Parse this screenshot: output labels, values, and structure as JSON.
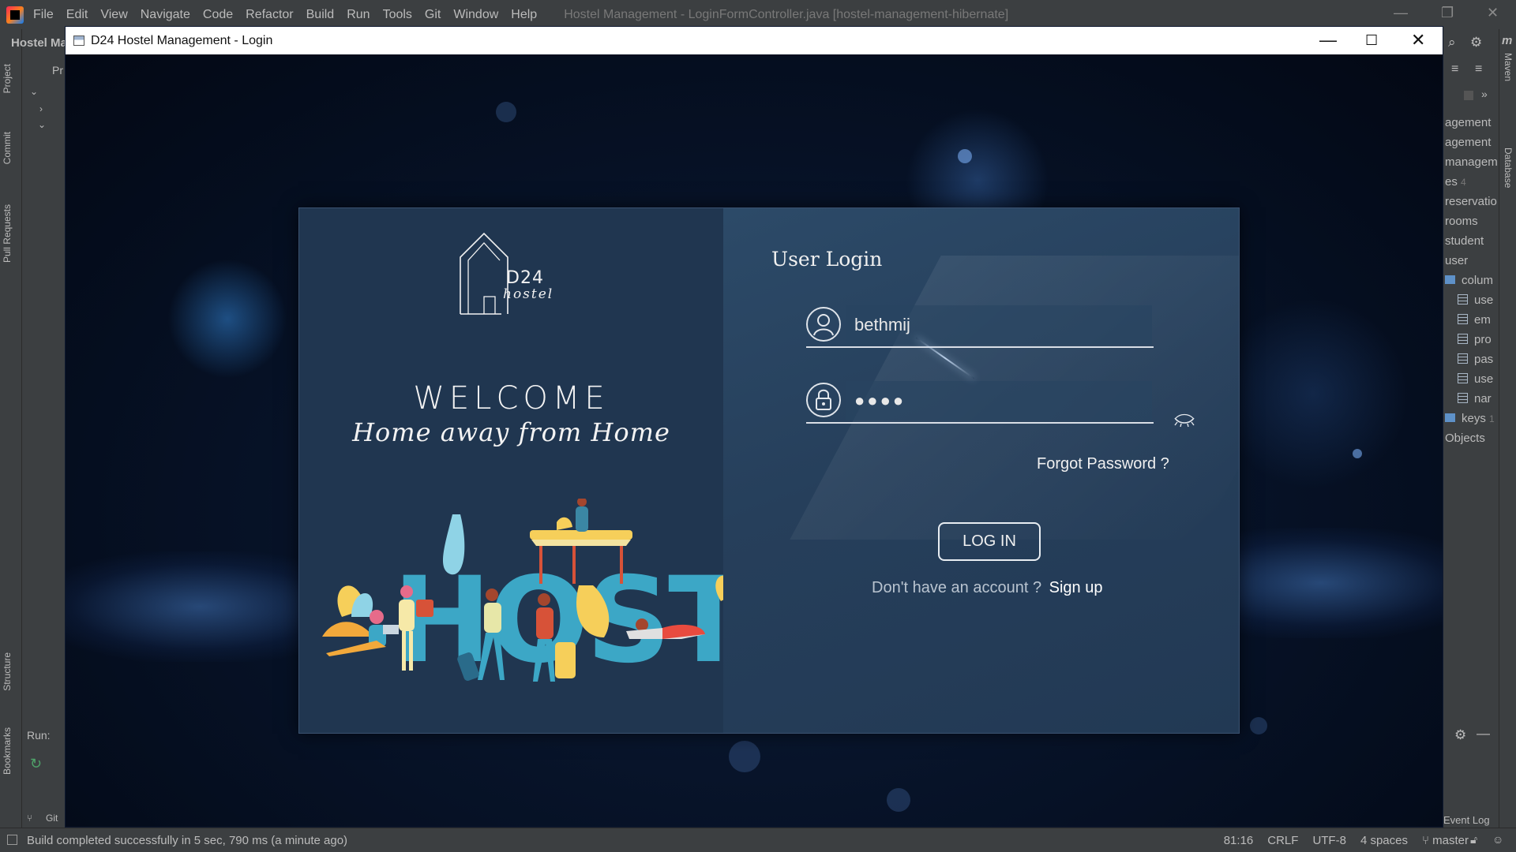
{
  "ide": {
    "menu": [
      "File",
      "Edit",
      "View",
      "Navigate",
      "Code",
      "Refactor",
      "Build",
      "Run",
      "Tools",
      "Git",
      "Window",
      "Help"
    ],
    "window_title": "Hostel Management - LoginFormController.java [hostel-management-hibernate]",
    "project_title": "Hostel Ma",
    "project_tab_label": "Pr",
    "left_tabs": [
      "Project",
      "Commit",
      "Pull Requests",
      "Structure",
      "Bookmarks"
    ],
    "right_tabs": [
      "Maven",
      "Database"
    ],
    "database_items": [
      "agement",
      "agement",
      "managem",
      "es",
      "reservatio",
      "rooms",
      "student",
      "user",
      "colum",
      "use",
      "em",
      "pro",
      "pas",
      "use",
      "nar",
      "keys",
      "Objects"
    ],
    "database_counts": {
      "es": "4",
      "keys": "1"
    },
    "run_label": "Run:",
    "git_label": "Git",
    "event_log": "Event Log",
    "status": {
      "message": "Build completed successfully in 5 sec, 790 ms (a minute ago)",
      "position": "81:16",
      "line_ending": "CRLF",
      "encoding": "UTF-8",
      "indent": "4 spaces",
      "branch": "master"
    }
  },
  "app": {
    "window_title": "D24 Hostel Management - Login",
    "logo": {
      "brand": "D24",
      "sub": "hostel"
    },
    "welcome": "WELCOME",
    "tagline": "Home away from Home",
    "hostel_word": "HOSTEL",
    "login": {
      "heading": "User Login",
      "username_value": "bethmij",
      "password_masked": "●●●●",
      "forgot_password": "Forgot Password ?",
      "login_button": "LOG IN",
      "signup_prompt": "Don't have an account ?",
      "signup_link": "Sign up"
    }
  }
}
